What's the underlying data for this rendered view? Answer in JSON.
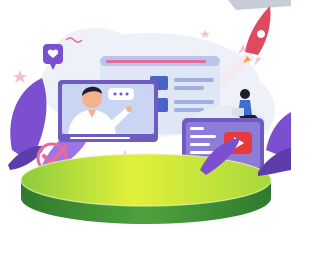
{
  "scene": {
    "icons": [
      "rocket-icon",
      "heart-icon",
      "checkmark-icon",
      "play-icon",
      "star-icon"
    ],
    "colors": {
      "background": "#ffffff",
      "cloud": "#eef1f8",
      "leaf_purple": "#7b4fd0",
      "leaf_purple_light": "#9d74e6",
      "screen_frame": "#6e5cc2",
      "screen_blue": "#c9d5f2",
      "accent_red": "#e8393b",
      "accent_pink": "#e66aa0",
      "platform_top": "#d9ee3c",
      "platform_side": "#3f8f3a",
      "platform_dark": "#2e6e2c",
      "rocket": "#e04a5f",
      "rocket_light": "#f3c7d7",
      "skin": "#f2b38c",
      "hair": "#1e1e2d"
    }
  }
}
